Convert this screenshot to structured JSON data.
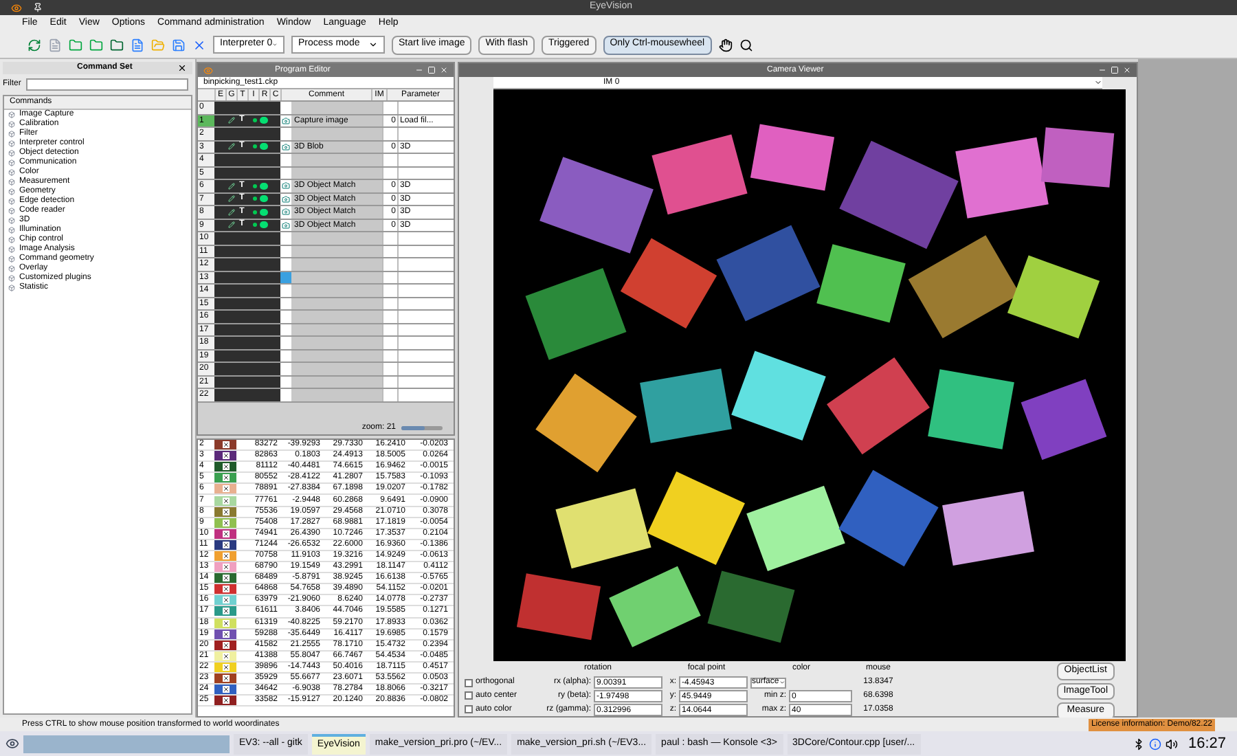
{
  "window": {
    "title": "EyeVision"
  },
  "menu": [
    "File",
    "Edit",
    "View",
    "Options",
    "Command administration",
    "Window",
    "Language",
    "Help"
  ],
  "toolbar": {
    "dropdowns": [
      {
        "value": "Interpreter 0"
      },
      {
        "value": "Process mode"
      }
    ],
    "buttons": [
      {
        "label": "Start live image",
        "selected": false
      },
      {
        "label": "With flash",
        "selected": false
      },
      {
        "label": "Triggered",
        "selected": false
      },
      {
        "label": "Only Ctrl-mousewheel",
        "selected": true
      }
    ]
  },
  "command_set": {
    "title": "Command Set",
    "filter_label": "Filter",
    "header": "Commands",
    "items": [
      "Image Capture",
      "Calibration",
      "Filter",
      "Interpreter control",
      "Object detection",
      "Communication",
      "Color",
      "Measurement",
      "Geometry",
      "Edge detection",
      "Code reader",
      "3D",
      "Illumination",
      "Chip control",
      "Image Analysis",
      "Command geometry",
      "Overlay",
      "Customized plugins",
      "Statistic"
    ]
  },
  "program_editor": {
    "title": "Program Editor",
    "file": "binpicking_test1.ckp",
    "columns": [
      "E",
      "G",
      "T",
      "I",
      "R",
      "C",
      "Comment",
      "IM",
      "Parameter"
    ],
    "zoom": "zoom: 21",
    "zoom_slider": {
      "level": 0.55
    },
    "rows": [
      {
        "number": "0",
        "kind": "empty",
        "selected": false,
        "focused": false
      },
      {
        "number": "1",
        "kind": "command",
        "t": "T",
        "comment": "Capture image",
        "im": "0",
        "parameter": "Load fil...",
        "selected": true,
        "focused": false
      },
      {
        "number": "2",
        "kind": "empty",
        "selected": false,
        "focused": false
      },
      {
        "number": "3",
        "kind": "command",
        "t": "T",
        "comment": "3D Blob",
        "im": "0",
        "parameter": "3D",
        "selected": false,
        "focused": false
      },
      {
        "number": "4",
        "kind": "empty",
        "selected": false,
        "focused": false
      },
      {
        "number": "5",
        "kind": "empty",
        "selected": false,
        "focused": false
      },
      {
        "number": "6",
        "kind": "command",
        "t": "T",
        "comment": "3D Object Match",
        "im": "0",
        "parameter": "3D",
        "selected": false,
        "focused": false
      },
      {
        "number": "7",
        "kind": "command",
        "t": "T",
        "comment": "3D Object Match",
        "im": "0",
        "parameter": "3D",
        "selected": false,
        "focused": false
      },
      {
        "number": "8",
        "kind": "command",
        "t": "T",
        "comment": "3D Object Match",
        "im": "0",
        "parameter": "3D",
        "selected": false,
        "focused": false
      },
      {
        "number": "9",
        "kind": "command",
        "t": "T",
        "comment": "3D Object Match",
        "im": "0",
        "parameter": "3D",
        "selected": false,
        "focused": false
      },
      {
        "number": "10",
        "kind": "empty",
        "selected": false,
        "focused": false
      },
      {
        "number": "11",
        "kind": "empty",
        "selected": false,
        "focused": false
      },
      {
        "number": "12",
        "kind": "empty",
        "selected": false,
        "focused": false
      },
      {
        "number": "13",
        "kind": "empty",
        "selected": false,
        "focused": true
      },
      {
        "number": "14",
        "kind": "empty",
        "selected": false,
        "focused": false
      },
      {
        "number": "15",
        "kind": "empty",
        "selected": false,
        "focused": false
      },
      {
        "number": "16",
        "kind": "empty",
        "selected": false,
        "focused": false
      },
      {
        "number": "17",
        "kind": "empty",
        "selected": false,
        "focused": false
      },
      {
        "number": "18",
        "kind": "empty",
        "selected": false,
        "focused": false
      },
      {
        "number": "19",
        "kind": "empty",
        "selected": false,
        "focused": false
      },
      {
        "number": "20",
        "kind": "empty",
        "selected": false,
        "focused": false
      },
      {
        "number": "21",
        "kind": "empty",
        "selected": false,
        "focused": false
      },
      {
        "number": "22",
        "kind": "empty",
        "selected": false,
        "focused": false
      }
    ]
  },
  "results_table": {
    "rows": [
      {
        "index": "2",
        "color": "#8b3a2a",
        "checked": true,
        "values": [
          "83272",
          "-39.9293",
          "29.7330",
          "16.2410",
          "-0.0203"
        ]
      },
      {
        "index": "3",
        "color": "#5b2a7a",
        "checked": true,
        "values": [
          "82863",
          "0.1803",
          "24.4913",
          "18.5005",
          "0.0264"
        ]
      },
      {
        "index": "4",
        "color": "#1f5a2a",
        "checked": true,
        "values": [
          "81112",
          "-40.4481",
          "74.6615",
          "16.9462",
          "-0.0015"
        ]
      },
      {
        "index": "5",
        "color": "#3aa050",
        "checked": true,
        "values": [
          "80552",
          "-28.4122",
          "41.2807",
          "15.7583",
          "-0.1093"
        ]
      },
      {
        "index": "6",
        "color": "#e8b090",
        "checked": true,
        "values": [
          "78891",
          "-27.8384",
          "67.1898",
          "19.0207",
          "-0.1782"
        ]
      },
      {
        "index": "7",
        "color": "#a8d8a0",
        "checked": true,
        "values": [
          "77761",
          "-2.9448",
          "60.2868",
          "9.6491",
          "-0.0900"
        ]
      },
      {
        "index": "8",
        "color": "#8a7a30",
        "checked": true,
        "values": [
          "75536",
          "19.0597",
          "29.4568",
          "21.0710",
          "0.3078"
        ]
      },
      {
        "index": "9",
        "color": "#90c050",
        "checked": true,
        "values": [
          "75408",
          "17.2827",
          "68.9881",
          "17.1819",
          "-0.0054"
        ]
      },
      {
        "index": "10",
        "color": "#c03080",
        "checked": true,
        "values": [
          "74941",
          "26.4390",
          "10.7246",
          "17.3537",
          "0.2104"
        ]
      },
      {
        "index": "11",
        "color": "#2a3a80",
        "checked": true,
        "values": [
          "71244",
          "-26.6532",
          "22.6000",
          "16.9360",
          "-0.1386"
        ]
      },
      {
        "index": "12",
        "color": "#f0a030",
        "checked": true,
        "values": [
          "70758",
          "11.9103",
          "19.3216",
          "14.9249",
          "-0.0613"
        ]
      },
      {
        "index": "13",
        "color": "#f0a0c0",
        "checked": true,
        "values": [
          "68790",
          "19.1549",
          "43.2991",
          "18.1147",
          "0.4112"
        ]
      },
      {
        "index": "14",
        "color": "#2a6a30",
        "checked": true,
        "values": [
          "68489",
          "-5.8791",
          "38.9245",
          "16.6138",
          "-0.5765"
        ]
      },
      {
        "index": "15",
        "color": "#d03030",
        "checked": true,
        "values": [
          "64868",
          "54.7658",
          "39.4890",
          "54.1152",
          "-0.0201"
        ]
      },
      {
        "index": "16",
        "color": "#70d0d0",
        "checked": true,
        "values": [
          "63979",
          "-21.9060",
          "8.6240",
          "14.0778",
          "-0.2737"
        ]
      },
      {
        "index": "17",
        "color": "#2a9a8a",
        "checked": true,
        "values": [
          "61611",
          "3.8406",
          "44.7046",
          "19.5585",
          "0.1271"
        ]
      },
      {
        "index": "18",
        "color": "#d0e060",
        "checked": true,
        "values": [
          "61319",
          "-40.8225",
          "59.2170",
          "17.8933",
          "0.0362"
        ]
      },
      {
        "index": "19",
        "color": "#7050b0",
        "checked": true,
        "values": [
          "59288",
          "-35.6449",
          "16.4117",
          "19.6985",
          "0.1579"
        ]
      },
      {
        "index": "20",
        "color": "#a02020",
        "checked": true,
        "values": [
          "41582",
          "21.2555",
          "78.1710",
          "15.4732",
          "0.2394"
        ]
      },
      {
        "index": "21",
        "color": "#f0f0a0",
        "checked": true,
        "values": [
          "41388",
          "55.8047",
          "66.7467",
          "54.4534",
          "-0.0485"
        ]
      },
      {
        "index": "22",
        "color": "#f0d020",
        "checked": true,
        "values": [
          "39896",
          "-14.7443",
          "50.4016",
          "18.7115",
          "0.4517"
        ]
      },
      {
        "index": "23",
        "color": "#a04020",
        "checked": true,
        "values": [
          "35929",
          "55.6677",
          "23.6071",
          "53.5562",
          "0.0503"
        ]
      },
      {
        "index": "24",
        "color": "#3060c0",
        "checked": true,
        "values": [
          "34642",
          "-6.9038",
          "78.2784",
          "18.8066",
          "-0.3217"
        ]
      },
      {
        "index": "25",
        "color": "#902020",
        "checked": true,
        "values": [
          "33582",
          "-15.9127",
          "20.1240",
          "20.8836",
          "-0.0802"
        ]
      }
    ]
  },
  "camera_viewer": {
    "title": "Camera Viewer",
    "tab": "IM 0",
    "headers": [
      "rotation",
      "focal point",
      "color",
      "mouse"
    ],
    "rows": [
      {
        "option": "orthogonal",
        "checked": false,
        "rot_label": "rx (alpha):",
        "rot": "9.00391",
        "focal_label": "x:",
        "focal": "-4.45943",
        "mouse": "13.8347"
      },
      {
        "option": "auto center",
        "checked": false,
        "rot_label": "ry (beta):",
        "rot": "-1.97498",
        "focal_label": "y:",
        "focal": "45.9449",
        "color_label": "min z:",
        "color_value": "0",
        "mouse": "68.6398"
      },
      {
        "option": "auto color",
        "checked": false,
        "rot_label": "rz (gamma):",
        "rot": "0.312996",
        "focal_label": "z:",
        "focal": "14.0644",
        "color_label": "max z:",
        "color_value": "40",
        "mouse": "17.0358"
      }
    ],
    "color_mode": "surface",
    "buttons": [
      "ObjectList",
      "ImageTool",
      "Measure"
    ]
  },
  "status_bar": {
    "message": "Press CTRL to show mouse position transformed to world woordinates",
    "license": "License information: Demo/82.22"
  },
  "taskbar": {
    "tasks": [
      {
        "label": "EV3: --all - gitk",
        "selected": false
      },
      {
        "label": "EyeVision",
        "selected": true
      },
      {
        "label": "make_version_pri.pro (~/EV...",
        "selected": false
      },
      {
        "label": "make_version_pri.sh (~/EV3...",
        "selected": false
      },
      {
        "label": "paul : bash — Konsole <3>",
        "selected": false
      },
      {
        "label": "3DCore/Contour.cpp [user/...",
        "selected": false
      }
    ],
    "clock": "16:27"
  }
}
